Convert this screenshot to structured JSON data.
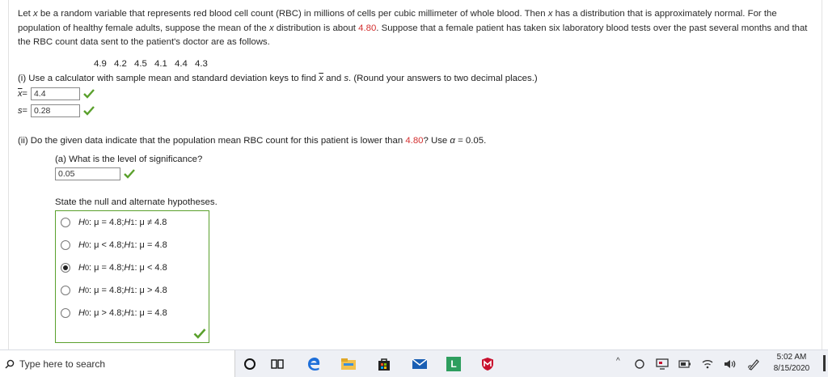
{
  "problem": {
    "p1": "Let ",
    "x1": "x",
    "p2": " be a random variable that represents red blood cell count (RBC) in millions of cells per cubic millimeter of whole blood. Then ",
    "x2": "x",
    "p3": " has a distribution that is approximately normal. For the population of healthy female adults, suppose the mean of the ",
    "x3": "x",
    "p4": " distribution is about ",
    "mean": "4.80",
    "p5": ". Suppose that a female patient has taken six laboratory blood tests over the past several months and that the RBC count data sent to the patient's doctor are as follows."
  },
  "data_values": "4.9  4.2  4.5  4.1  4.4  4.3",
  "part1": {
    "prefix": "(i) Use a calculator with sample mean and standard deviation keys to find ",
    "xbar": "x",
    "and": " and ",
    "s": "s",
    "suffix": ". (Round your answers to two decimal places.)",
    "xbar_label": "x",
    "xbar_eq": " =",
    "xbar_value": "4.4",
    "s_label": "s",
    "s_eq": " =",
    "s_value": "0.28"
  },
  "part2": {
    "prefix": "(ii) Do the given data indicate that the population mean RBC count for this patient is lower than ",
    "mean": "4.80",
    "suffix": "? Use ",
    "alpha": "α",
    "alpha_eq": " = 0.05."
  },
  "part_a": {
    "question": "(a) What is the level of significance?",
    "value": "0.05"
  },
  "hypotheses": {
    "label": "State the null and alternate hypotheses.",
    "options": [
      {
        "h0": "H",
        "h0sub": "0",
        "h0rest": ": μ = 4.8; ",
        "h1": "H",
        "h1sub": "1",
        "h1rest": ": μ ≠ 4.8",
        "selected": false
      },
      {
        "h0": "H",
        "h0sub": "0",
        "h0rest": ": μ < 4.8; ",
        "h1": "H",
        "h1sub": "1",
        "h1rest": ": μ = 4.8",
        "selected": false
      },
      {
        "h0": "H",
        "h0sub": "0",
        "h0rest": ": μ = 4.8; ",
        "h1": "H",
        "h1sub": "1",
        "h1rest": ": μ < 4.8",
        "selected": true
      },
      {
        "h0": "H",
        "h0sub": "0",
        "h0rest": ": μ = 4.8; ",
        "h1": "H",
        "h1sub": "1",
        "h1rest": ": μ > 4.8",
        "selected": false
      },
      {
        "h0": "H",
        "h0sub": "0",
        "h0rest": ": μ > 4.8; ",
        "h1": "H",
        "h1sub": "1",
        "h1rest": ": μ = 4.8",
        "selected": false
      }
    ]
  },
  "colors": {
    "accent_red": "#d32f2f",
    "check_green": "#5aa02c",
    "edge_blue": "#1e6fd9"
  },
  "taskbar": {
    "search_placeholder": "Type here to search",
    "store_letter": "L",
    "time": "5:02 AM",
    "date": "8/15/2020"
  }
}
